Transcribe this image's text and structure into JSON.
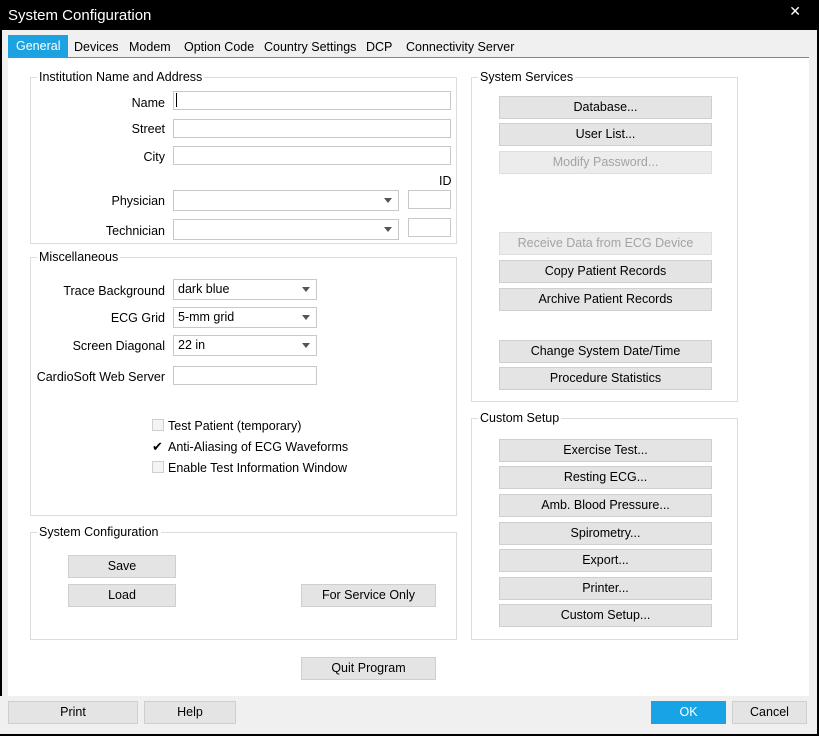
{
  "window": {
    "title": "System Configuration",
    "close_glyph": "✕"
  },
  "tabs": [
    {
      "label": "General",
      "active": true
    },
    {
      "label": "Devices"
    },
    {
      "label": "Modem"
    },
    {
      "label": "Option Code"
    },
    {
      "label": "Country Settings"
    },
    {
      "label": "DCP"
    },
    {
      "label": "Connectivity Server"
    }
  ],
  "institution": {
    "title": "Institution Name and Address",
    "name_label": "Name",
    "name_value": "",
    "street_label": "Street",
    "street_value": "",
    "city_label": "City",
    "city_value": "",
    "id_label": "ID",
    "physician_label": "Physician",
    "physician_value": "",
    "physician_id": "",
    "technician_label": "Technician",
    "technician_value": "",
    "technician_id": ""
  },
  "misc": {
    "title": "Miscellaneous",
    "trace_bg_label": "Trace Background",
    "trace_bg_value": "dark blue",
    "ecg_grid_label": "ECG Grid",
    "ecg_grid_value": "5-mm grid",
    "screen_diag_label": "Screen Diagonal",
    "screen_diag_value": "22 in",
    "web_server_label": "CardioSoft Web Server",
    "web_server_value": "",
    "test_patient_label": "Test Patient (temporary)",
    "test_patient_checked": false,
    "anti_alias_label": "Anti-Aliasing of ECG Waveforms",
    "anti_alias_checked": true,
    "anti_alias_glyph": "✔",
    "test_info_label": "Enable Test Information Window",
    "test_info_checked": false
  },
  "sysconfig": {
    "title": "System Configuration",
    "save": "Save",
    "load": "Load",
    "service": "For Service Only"
  },
  "services": {
    "title": "System Services",
    "database": "Database...",
    "user_list": "User List...",
    "modify_password": "Modify Password...",
    "receive_data": "Receive Data from ECG Device",
    "copy_records": "Copy Patient Records",
    "archive_records": "Archive Patient Records",
    "change_date": "Change System Date/Time",
    "procedure_stats": "Procedure Statistics"
  },
  "custom": {
    "title": "Custom Setup",
    "exercise": "Exercise Test...",
    "resting": "Resting ECG...",
    "amb_bp": "Amb. Blood Pressure...",
    "spirometry": "Spirometry...",
    "export": "Export...",
    "printer": "Printer...",
    "custom_setup": "Custom Setup..."
  },
  "quit": "Quit Program",
  "footer": {
    "print": "Print",
    "help": "Help",
    "ok": "OK",
    "cancel": "Cancel"
  },
  "colors": {
    "accent": "#1ca2e0"
  }
}
